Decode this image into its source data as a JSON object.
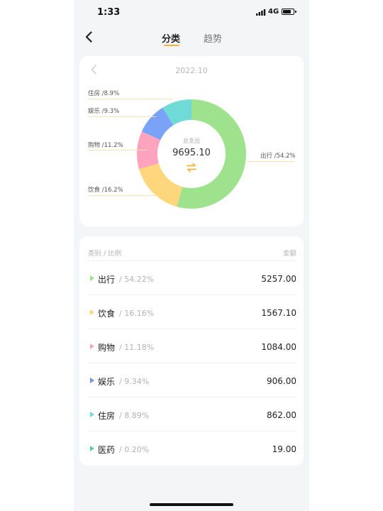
{
  "status_bar": {
    "time": "1:33",
    "network": "4G",
    "battery_level": 0.8
  },
  "nav": {
    "tabs": [
      {
        "label": "分类",
        "active": true
      },
      {
        "label": "趋势",
        "active": false
      }
    ]
  },
  "summary": {
    "month": "2022.10",
    "total_label": "总支出",
    "total": "9695.10",
    "swap_icon": "swap-icon"
  },
  "chart_data": {
    "type": "pie",
    "subtype": "donut",
    "slices": [
      {
        "label": "出行",
        "percent": 54.2,
        "label_text": "出行 /54.2%",
        "color": "#9ee28d"
      },
      {
        "label": "饮食",
        "percent": 16.2,
        "label_text": "饮食 /16.2%",
        "color": "#fed67c"
      },
      {
        "label": "购物",
        "percent": 11.2,
        "label_text": "购物 /11.2%",
        "color": "#ffa3bf"
      },
      {
        "label": "娱乐",
        "percent": 9.3,
        "label_text": "娱乐 /9.3%",
        "color": "#7aa2f7"
      },
      {
        "label": "住房",
        "percent": 8.9,
        "label_text": "住房 /8.9%",
        "color": "#6fdad6"
      }
    ]
  },
  "table": {
    "header_left": "类别 / 比例",
    "header_right": "金额",
    "rows": [
      {
        "name": "出行",
        "pct": "/ 54.22%",
        "amount": "5257.00",
        "color": "#9ee28d"
      },
      {
        "name": "饮食",
        "pct": "/ 16.16%",
        "amount": "1567.10",
        "color": "#fed67c"
      },
      {
        "name": "购物",
        "pct": "/ 11.18%",
        "amount": "1084.00",
        "color": "#ffa3bf"
      },
      {
        "name": "娱乐",
        "pct": "/ 9.34%",
        "amount": "906.00",
        "color": "#6f8fe8"
      },
      {
        "name": "住房",
        "pct": "/ 8.89%",
        "amount": "862.00",
        "color": "#6fdad6"
      },
      {
        "name": "医药",
        "pct": "/ 0.20%",
        "amount": "19.00",
        "color": "#5ec9a8"
      }
    ]
  }
}
